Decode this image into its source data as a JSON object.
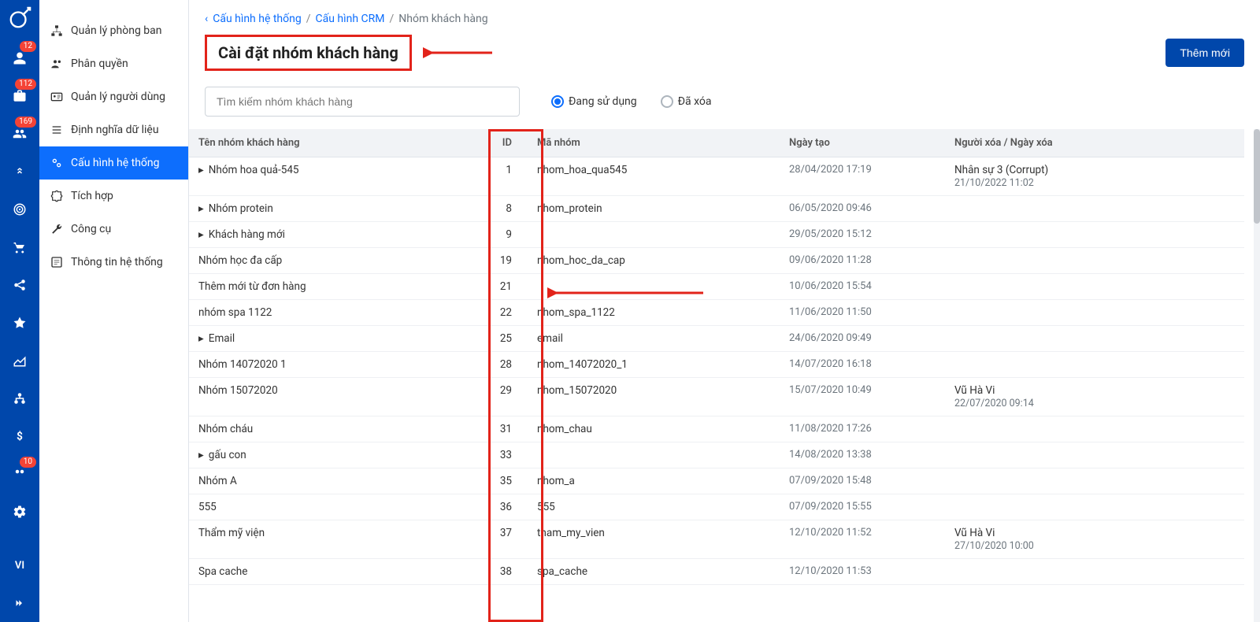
{
  "iconbar": {
    "badges": {
      "0": "12",
      "1": "112",
      "2": "169",
      "11": "10"
    },
    "lang": "VI"
  },
  "sidebar": {
    "items": [
      {
        "label": "Quản lý phòng ban"
      },
      {
        "label": "Phân quyền"
      },
      {
        "label": "Quản lý người dùng"
      },
      {
        "label": "Định nghĩa dữ liệu"
      },
      {
        "label": "Cấu hình hệ thống"
      },
      {
        "label": "Tích hợp"
      },
      {
        "label": "Công cụ"
      },
      {
        "label": "Thông tin hệ thống"
      }
    ],
    "active_index": 4
  },
  "breadcrumbs": {
    "items": [
      "Cấu hình hệ thống",
      "Cấu hình CRM",
      "Nhóm khách hàng"
    ]
  },
  "page": {
    "title": "Cài đặt nhóm khách hàng",
    "add_button": "Thêm mới",
    "search_placeholder": "Tìm kiếm nhóm khách hàng",
    "filter_active": "Đang sử dụng",
    "filter_deleted": "Đã xóa"
  },
  "table": {
    "headers": {
      "name": "Tên nhóm khách hàng",
      "id": "ID",
      "code": "Mã nhóm",
      "created": "Ngày tạo",
      "deleted": "Người xóa / Ngày xóa"
    },
    "rows": [
      {
        "caret": true,
        "name": "Nhóm hoa quả-545",
        "id": "1",
        "code": "nhom_hoa_qua545",
        "created": "28/04/2020 17:19",
        "del_who": "Nhân sự 3 (Corrupt)",
        "del_when": "21/10/2022 11:02"
      },
      {
        "caret": true,
        "name": "Nhóm protein",
        "id": "8",
        "code": "nhom_protein",
        "created": "06/05/2020 09:46",
        "del_who": "",
        "del_when": ""
      },
      {
        "caret": true,
        "name": "Khách hàng mới",
        "id": "9",
        "code": "",
        "created": "29/05/2020 15:12",
        "del_who": "",
        "del_when": ""
      },
      {
        "caret": false,
        "name": "Nhóm học đa cấp",
        "id": "19",
        "code": "nhom_hoc_da_cap",
        "created": "09/06/2020 11:28",
        "del_who": "",
        "del_when": ""
      },
      {
        "caret": false,
        "name": "Thêm mới từ đơn hàng",
        "id": "21",
        "code": "",
        "created": "10/06/2020 15:54",
        "del_who": "",
        "del_when": ""
      },
      {
        "caret": false,
        "name": "nhóm spa 1122",
        "id": "22",
        "code": "nhom_spa_1122",
        "created": "11/06/2020 11:50",
        "del_who": "",
        "del_when": ""
      },
      {
        "caret": true,
        "name": "Email",
        "id": "25",
        "code": "email",
        "created": "24/06/2020 09:49",
        "del_who": "",
        "del_when": ""
      },
      {
        "caret": false,
        "name": "Nhóm 14072020 1",
        "id": "28",
        "code": "nhom_14072020_1",
        "created": "14/07/2020 16:18",
        "del_who": "",
        "del_when": ""
      },
      {
        "caret": false,
        "name": "Nhóm 15072020",
        "id": "29",
        "code": "nhom_15072020",
        "created": "15/07/2020 10:49",
        "del_who": "Vũ Hà Vi",
        "del_when": "22/07/2020 09:14"
      },
      {
        "caret": false,
        "name": "Nhóm cháu",
        "id": "31",
        "code": "nhom_chau",
        "created": "11/08/2020 17:26",
        "del_who": "",
        "del_when": ""
      },
      {
        "caret": true,
        "name": "gấu con",
        "id": "33",
        "code": "",
        "created": "14/08/2020 13:38",
        "del_who": "",
        "del_when": ""
      },
      {
        "caret": false,
        "name": "Nhóm A",
        "id": "35",
        "code": "nhom_a",
        "created": "07/09/2020 15:48",
        "del_who": "",
        "del_when": ""
      },
      {
        "caret": false,
        "name": "555",
        "id": "36",
        "code": "555",
        "created": "07/09/2020 15:55",
        "del_who": "",
        "del_when": ""
      },
      {
        "caret": false,
        "name": "Thẩm mỹ viện",
        "id": "37",
        "code": "tham_my_vien",
        "created": "12/10/2020 11:52",
        "del_who": "Vũ Hà Vi",
        "del_when": "27/10/2020 10:00"
      },
      {
        "caret": false,
        "name": "Spa cache",
        "id": "38",
        "code": "spa_cache",
        "created": "12/10/2020 11:53",
        "del_who": "",
        "del_when": ""
      }
    ]
  }
}
